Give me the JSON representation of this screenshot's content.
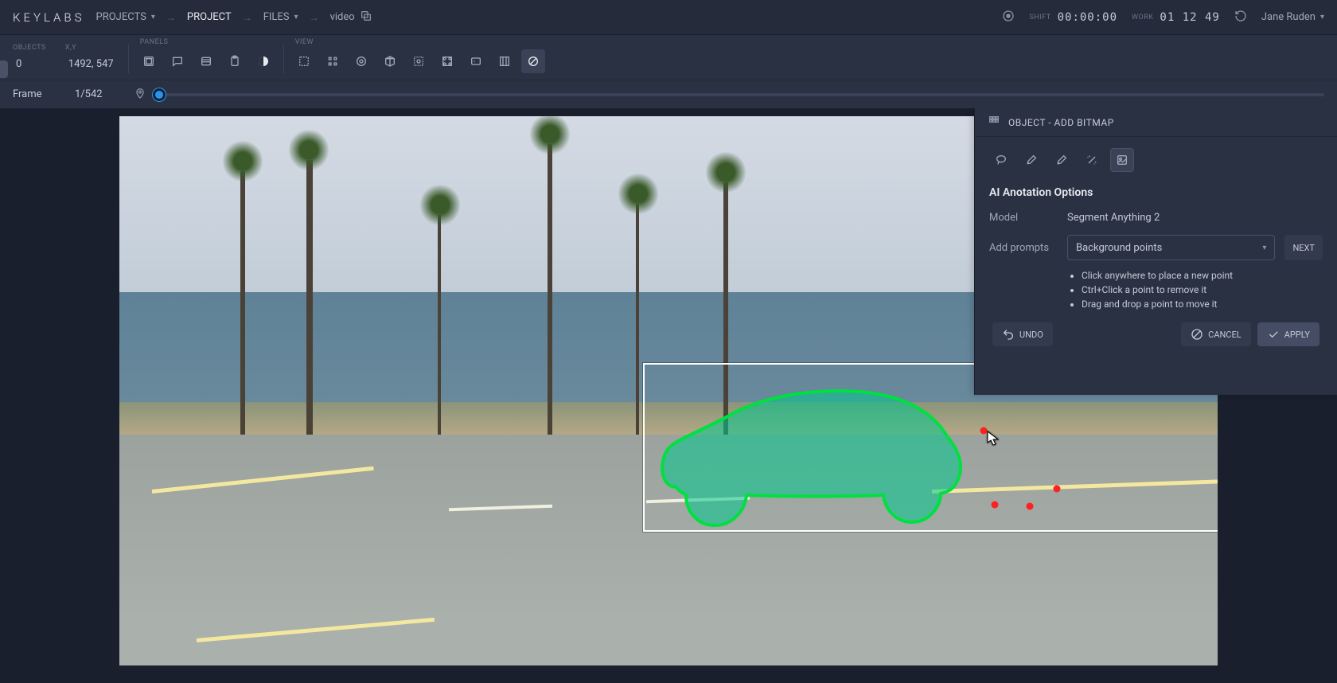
{
  "header": {
    "logo": "KEYLABS",
    "projects_label": "PROJECTS",
    "project_label": "PROJECT",
    "files_label": "FILES",
    "file_name": "video",
    "shift_label": "SHIFT",
    "shift_time": "00:00:00",
    "work_label": "WORK",
    "work_time": "01 12 49",
    "user_name": "Jane Ruden"
  },
  "toolbar": {
    "objects_label": "Objects",
    "objects_count": "0",
    "xy_label": "X,Y",
    "xy_value": "1492, 547",
    "panels_label": "Panels",
    "view_label": "View"
  },
  "framebar": {
    "label": "Frame",
    "value": "1/542"
  },
  "panel": {
    "title": "OBJECT - ADD BITMAP",
    "section_title": "AI Anotation Options",
    "model_label": "Model",
    "model_value": "Segment Anything 2",
    "prompts_label": "Add prompts",
    "prompts_value": "Background points",
    "next_label": "NEXT",
    "hints": [
      "Click anywhere to place a new point",
      "Ctrl+Click a point to remove it",
      "Drag and drop a point to move it"
    ],
    "undo_label": "UNDO",
    "cancel_label": "CANCEL",
    "apply_label": "APPLY"
  }
}
